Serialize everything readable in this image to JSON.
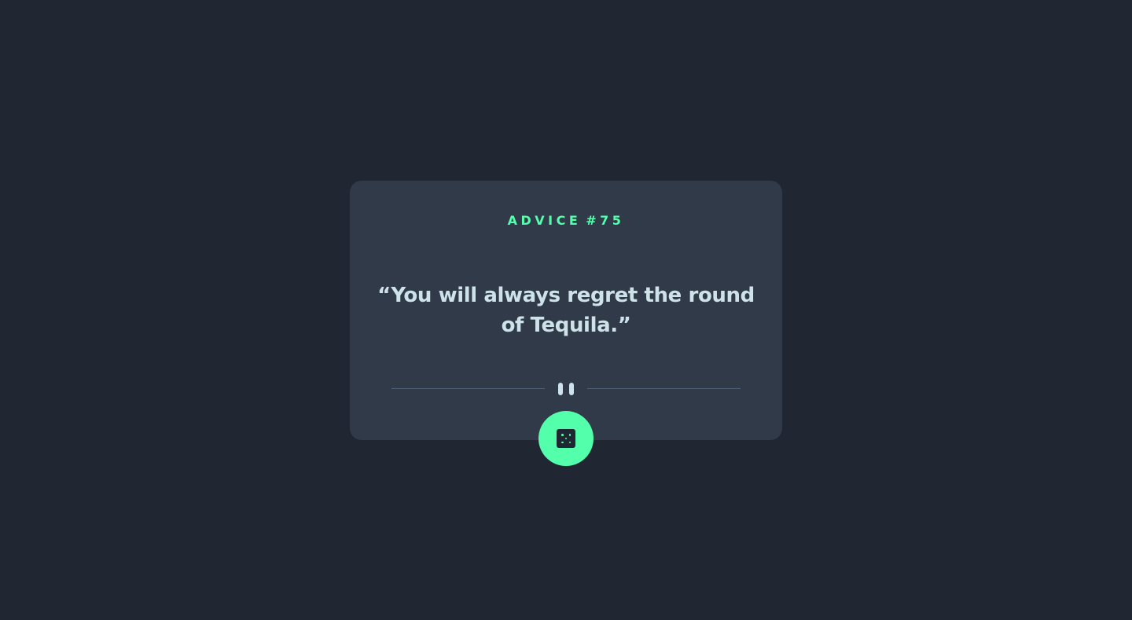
{
  "card": {
    "label_word": "ADVICE",
    "label_number": "#75",
    "quote": "“You will always regret the round of Tequila.”"
  },
  "icons": {
    "divider": "pause-icon",
    "button": "dice-icon"
  },
  "colors": {
    "background": "#202733",
    "card": "#313a48",
    "accent": "#53ffaa",
    "text": "#cee3e9",
    "divider": "#4f5d74"
  }
}
